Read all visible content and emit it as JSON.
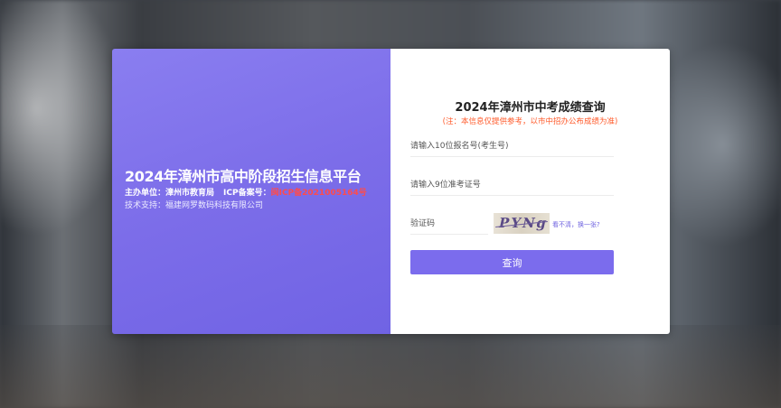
{
  "platform": {
    "title": "2024年漳州市高中阶段招生信息平台",
    "host_label": "主办单位：",
    "host_value": "漳州市教育局",
    "icp_label": "ICP备案号：",
    "icp_value": "闽ICP备2021005164号",
    "tech_support": "技术支持：福建网罗数码科技有限公司"
  },
  "form": {
    "title": "2024年漳州市中考成绩查询",
    "note": "(注：本信息仅提供参考，以市中招办公布成绩为准)",
    "id_placeholder": "请输入10位报名号(考生号)",
    "exam_placeholder": "请输入9位准考证号",
    "captcha_placeholder": "验证码",
    "captcha_text": "PYNg",
    "captcha_refresh": "看不清，换一张?",
    "submit_label": "查询"
  },
  "colors": {
    "accent": "#7b6ced",
    "note": "#ff5a2a",
    "icp": "#ff4b4b"
  }
}
